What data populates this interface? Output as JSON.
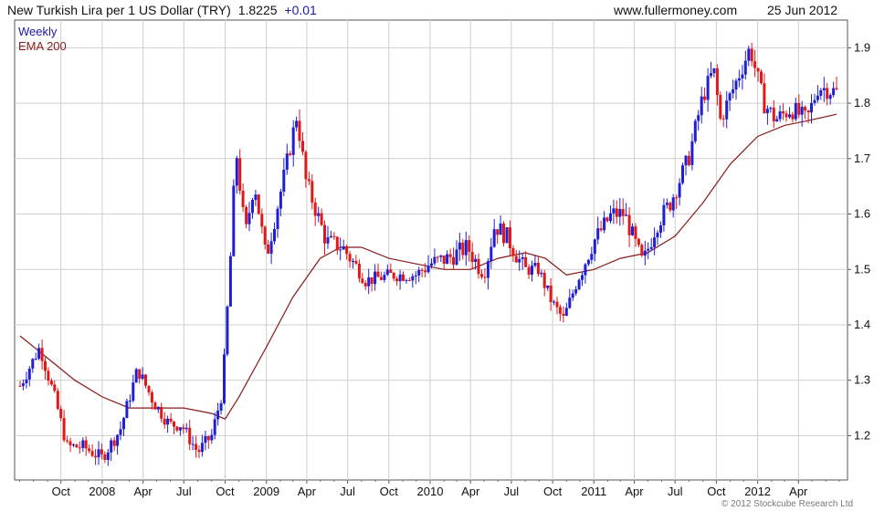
{
  "header": {
    "title": "New Turkish Lira per 1 US Dollar (TRY)",
    "last_value": "1.8225",
    "change": "+0.01",
    "site": "www.fullermoney.com",
    "date": "25 Jun 2012"
  },
  "copyright": "© 2012 Stockcube Research Ltd",
  "colors": {
    "up": "#1f1fd6",
    "down": "#e01818",
    "ema": "#8b1a1a",
    "grid": "#cfcfcf",
    "legend_weekly": "#1a1aa6",
    "legend_ema": "#8b1a1a"
  },
  "chart_data": {
    "type": "candlestick",
    "frequency_label": "Weekly",
    "indicator_label": "EMA 200",
    "x_labels": [
      "Oct",
      "2008",
      "Apr",
      "Jul",
      "Oct",
      "2009",
      "Apr",
      "Jul",
      "Oct",
      "2010",
      "Apr",
      "Jul",
      "Oct",
      "2011",
      "Apr",
      "Jul",
      "Oct",
      "2012",
      "Apr"
    ],
    "y_ticks": [
      1.2,
      1.3,
      1.4,
      1.5,
      1.6,
      1.7,
      1.8,
      1.9
    ],
    "ylim": [
      1.12,
      1.95
    ],
    "y_axis_side": "right",
    "grid": true,
    "close_series": [
      {
        "d": "2007-07-02",
        "v": 1.29
      },
      {
        "d": "2007-08-15",
        "v": 1.36
      },
      {
        "d": "2007-09-20",
        "v": 1.26
      },
      {
        "d": "2007-10-15",
        "v": 1.18
      },
      {
        "d": "2007-11-20",
        "v": 1.18
      },
      {
        "d": "2007-12-31",
        "v": 1.16
      },
      {
        "d": "2008-02-10",
        "v": 1.21
      },
      {
        "d": "2008-03-20",
        "v": 1.32
      },
      {
        "d": "2008-04-25",
        "v": 1.26
      },
      {
        "d": "2008-05-30",
        "v": 1.22
      },
      {
        "d": "2008-06-25",
        "v": 1.22
      },
      {
        "d": "2008-08-01",
        "v": 1.17
      },
      {
        "d": "2008-09-01",
        "v": 1.2
      },
      {
        "d": "2008-09-25",
        "v": 1.28
      },
      {
        "d": "2008-10-15",
        "v": 1.55
      },
      {
        "d": "2008-10-25",
        "v": 1.72
      },
      {
        "d": "2008-11-15",
        "v": 1.56
      },
      {
        "d": "2008-12-05",
        "v": 1.66
      },
      {
        "d": "2008-12-31",
        "v": 1.52
      },
      {
        "d": "2009-02-10",
        "v": 1.67
      },
      {
        "d": "2009-03-10",
        "v": 1.78
      },
      {
        "d": "2009-03-30",
        "v": 1.66
      },
      {
        "d": "2009-05-15",
        "v": 1.55
      },
      {
        "d": "2009-06-20",
        "v": 1.54
      },
      {
        "d": "2009-08-10",
        "v": 1.48
      },
      {
        "d": "2009-10-10",
        "v": 1.49
      },
      {
        "d": "2009-11-30",
        "v": 1.49
      },
      {
        "d": "2009-12-31",
        "v": 1.51
      },
      {
        "d": "2010-02-10",
        "v": 1.52
      },
      {
        "d": "2010-03-25",
        "v": 1.54
      },
      {
        "d": "2010-05-01",
        "v": 1.49
      },
      {
        "d": "2010-05-25",
        "v": 1.58
      },
      {
        "d": "2010-06-20",
        "v": 1.56
      },
      {
        "d": "2010-07-30",
        "v": 1.5
      },
      {
        "d": "2010-08-30",
        "v": 1.5
      },
      {
        "d": "2010-09-30",
        "v": 1.44
      },
      {
        "d": "2010-10-25",
        "v": 1.41
      },
      {
        "d": "2010-11-25",
        "v": 1.48
      },
      {
        "d": "2010-12-31",
        "v": 1.55
      },
      {
        "d": "2011-02-10",
        "v": 1.6
      },
      {
        "d": "2011-03-10",
        "v": 1.6
      },
      {
        "d": "2011-04-20",
        "v": 1.51
      },
      {
        "d": "2011-05-20",
        "v": 1.58
      },
      {
        "d": "2011-06-20",
        "v": 1.62
      },
      {
        "d": "2011-07-31",
        "v": 1.7
      },
      {
        "d": "2011-08-31",
        "v": 1.81
      },
      {
        "d": "2011-09-25",
        "v": 1.86
      },
      {
        "d": "2011-10-10",
        "v": 1.77
      },
      {
        "d": "2011-11-20",
        "v": 1.85
      },
      {
        "d": "2011-12-15",
        "v": 1.9
      },
      {
        "d": "2012-01-15",
        "v": 1.8
      },
      {
        "d": "2012-02-10",
        "v": 1.77
      },
      {
        "d": "2012-03-15",
        "v": 1.79
      },
      {
        "d": "2012-04-20",
        "v": 1.77
      },
      {
        "d": "2012-05-15",
        "v": 1.83
      },
      {
        "d": "2012-06-25",
        "v": 1.82
      }
    ],
    "ema200": [
      {
        "d": "2007-07-02",
        "v": 1.38
      },
      {
        "d": "2007-09-01",
        "v": 1.34
      },
      {
        "d": "2007-11-01",
        "v": 1.3
      },
      {
        "d": "2008-01-01",
        "v": 1.27
      },
      {
        "d": "2008-03-01",
        "v": 1.25
      },
      {
        "d": "2008-05-01",
        "v": 1.25
      },
      {
        "d": "2008-07-01",
        "v": 1.25
      },
      {
        "d": "2008-09-01",
        "v": 1.24
      },
      {
        "d": "2008-10-01",
        "v": 1.23
      },
      {
        "d": "2008-11-01",
        "v": 1.27
      },
      {
        "d": "2009-01-01",
        "v": 1.36
      },
      {
        "d": "2009-03-01",
        "v": 1.45
      },
      {
        "d": "2009-05-01",
        "v": 1.52
      },
      {
        "d": "2009-06-15",
        "v": 1.54
      },
      {
        "d": "2009-08-01",
        "v": 1.54
      },
      {
        "d": "2009-10-01",
        "v": 1.52
      },
      {
        "d": "2009-12-01",
        "v": 1.51
      },
      {
        "d": "2010-02-01",
        "v": 1.5
      },
      {
        "d": "2010-04-01",
        "v": 1.5
      },
      {
        "d": "2010-06-01",
        "v": 1.52
      },
      {
        "d": "2010-08-01",
        "v": 1.53
      },
      {
        "d": "2010-09-15",
        "v": 1.52
      },
      {
        "d": "2010-11-01",
        "v": 1.49
      },
      {
        "d": "2011-01-01",
        "v": 1.5
      },
      {
        "d": "2011-03-01",
        "v": 1.52
      },
      {
        "d": "2011-05-01",
        "v": 1.53
      },
      {
        "d": "2011-07-01",
        "v": 1.56
      },
      {
        "d": "2011-09-01",
        "v": 1.62
      },
      {
        "d": "2011-11-01",
        "v": 1.69
      },
      {
        "d": "2012-01-01",
        "v": 1.74
      },
      {
        "d": "2012-03-01",
        "v": 1.76
      },
      {
        "d": "2012-05-01",
        "v": 1.77
      },
      {
        "d": "2012-06-25",
        "v": 1.78
      }
    ]
  }
}
